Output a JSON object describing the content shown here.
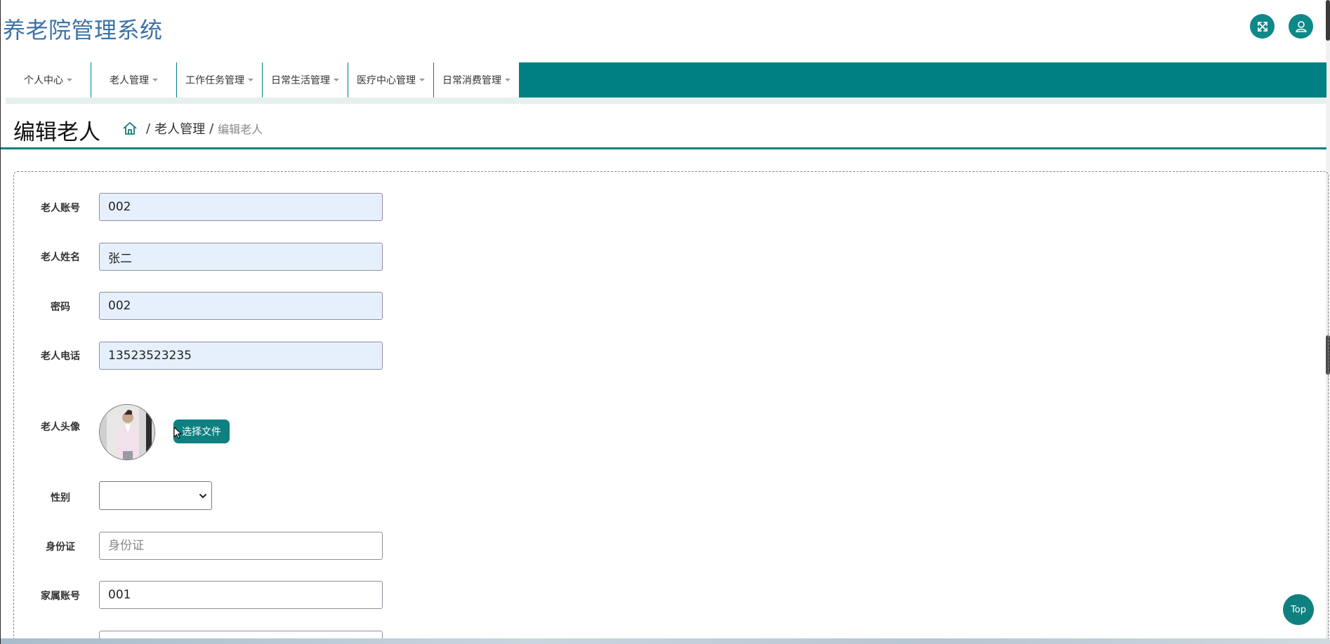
{
  "app": {
    "title": "养老院管理系统"
  },
  "header": {
    "fullscreen_icon": "expand-arrows-icon",
    "user_icon": "user-icon"
  },
  "nav": {
    "items": [
      {
        "label": "个人中心"
      },
      {
        "label": "老人管理"
      },
      {
        "label": "工作任务管理"
      },
      {
        "label": "日常生活管理"
      },
      {
        "label": "医疗中心管理"
      },
      {
        "label": "日常消费管理"
      }
    ]
  },
  "page": {
    "title": "编辑老人",
    "breadcrumb": {
      "separator": "/",
      "section": "老人管理",
      "current": "编辑老人"
    }
  },
  "form": {
    "account": {
      "label": "老人账号",
      "value": "002"
    },
    "name": {
      "label": "老人姓名",
      "value": "张二"
    },
    "password": {
      "label": "密码",
      "value": "002"
    },
    "phone": {
      "label": "老人电话",
      "value": "13523523235"
    },
    "avatar": {
      "label": "老人头像",
      "button": "选择文件"
    },
    "gender": {
      "label": "性别",
      "value": ""
    },
    "id_card": {
      "label": "身份证",
      "placeholder": "身份证",
      "value": ""
    },
    "family_account": {
      "label": "家属账号",
      "value": "001"
    }
  },
  "top_button": {
    "label": "Top"
  },
  "colors": {
    "primary": "#008080",
    "title_blue": "#3b73a8",
    "input_fill": "#e6f0fc"
  }
}
